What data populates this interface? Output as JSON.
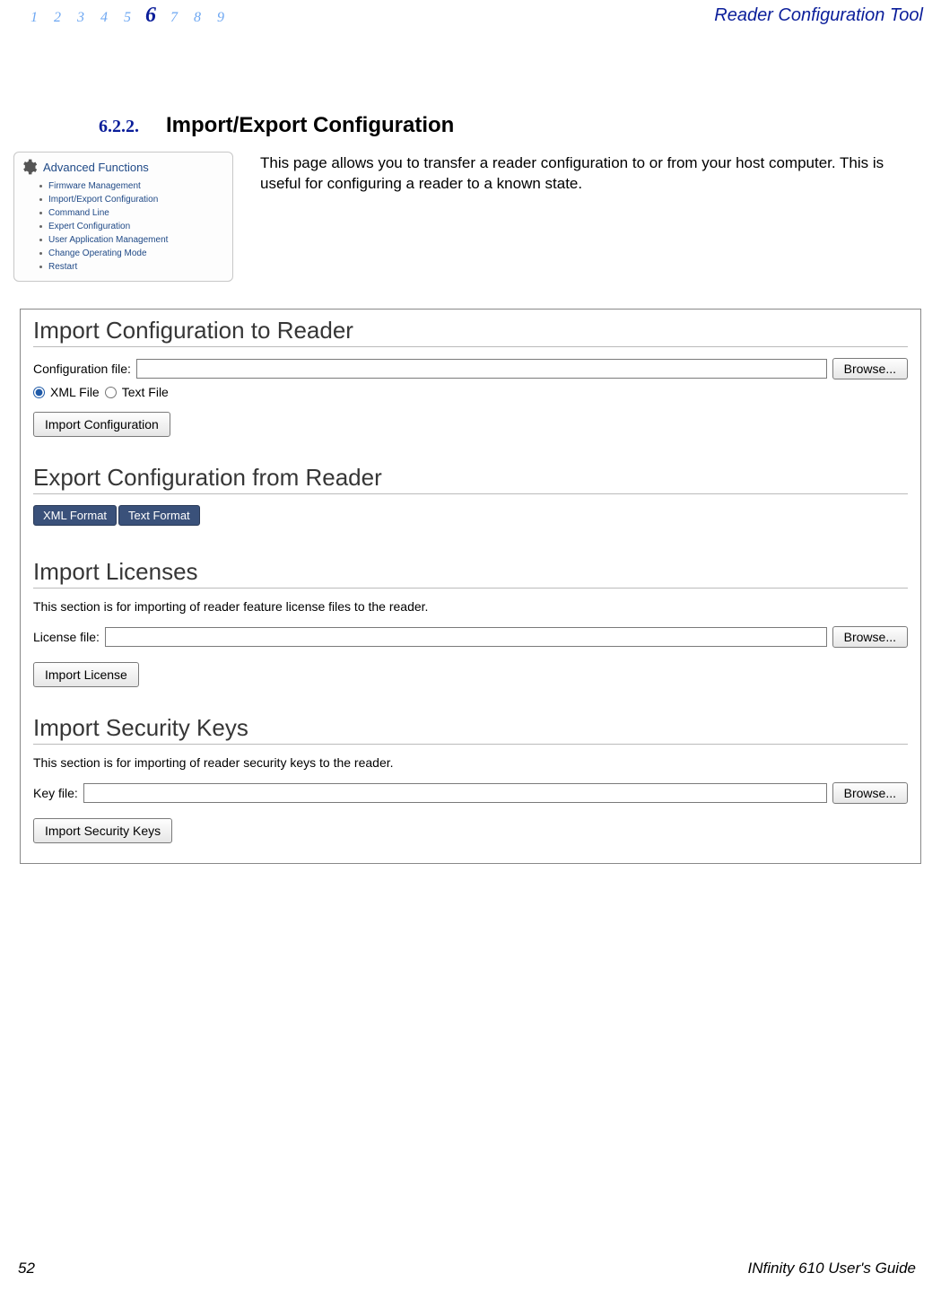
{
  "nav": {
    "items": [
      "1",
      "2",
      "3",
      "4",
      "5",
      "6",
      "7",
      "8",
      "9"
    ],
    "active_index": 5
  },
  "header_title": "Reader Configuration Tool",
  "section": {
    "num": "6.2.2.",
    "title": "Import/Export Configuration"
  },
  "intro_text": "This page allows you to transfer a reader configuration to or from your host computer. This is useful for configuring a reader to a known state.",
  "adv_panel": {
    "title": "Advanced Functions",
    "items": [
      "Firmware Management",
      "Import/Export Configuration",
      "Command Line",
      "Expert Configuration",
      "User Application Management",
      "Change Operating Mode",
      "Restart"
    ]
  },
  "panel": {
    "import_heading": "Import Configuration to Reader",
    "config_file_label": "Configuration file:",
    "browse_label": "Browse...",
    "radio_xml": "XML File",
    "radio_text": "Text File",
    "import_config_btn": "Import Configuration",
    "export_heading": "Export Configuration from Reader",
    "tab_xml": "XML Format",
    "tab_text": "Text Format",
    "import_lic_heading": "Import Licenses",
    "import_lic_desc": "This section is for importing of reader feature license files to the reader.",
    "license_file_label": "License file:",
    "import_lic_btn": "Import License",
    "import_keys_heading": "Import Security Keys",
    "import_keys_desc": "This section is for importing of reader security keys to the reader.",
    "key_file_label": "Key file:",
    "import_keys_btn": "Import Security Keys"
  },
  "footer": {
    "page_num": "52",
    "guide_prefix": "IN",
    "guide_italic": "finity",
    "guide_rest": " 610 User's Guide"
  }
}
